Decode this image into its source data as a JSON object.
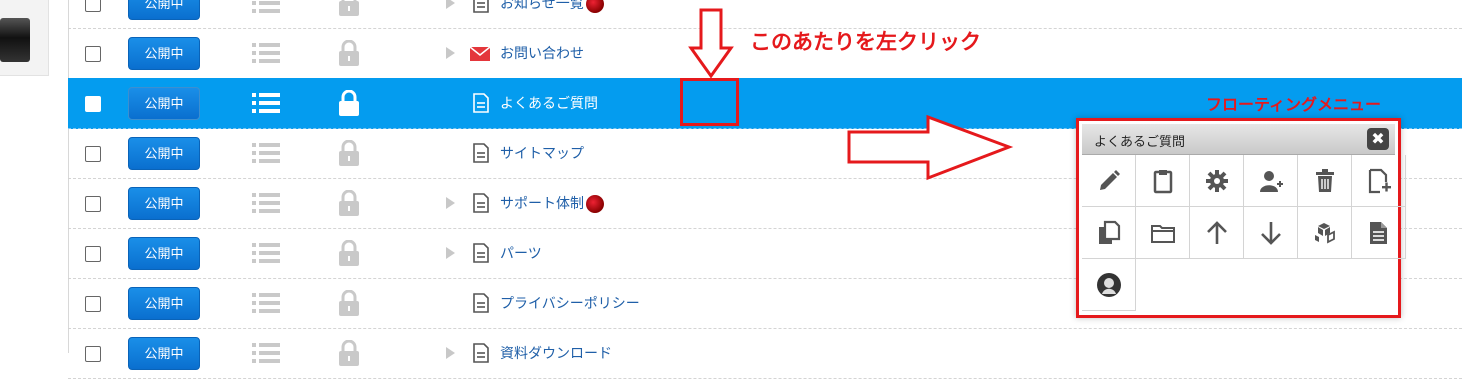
{
  "rows": [
    {
      "status": "公開中",
      "title": "お知らせ一覧",
      "has_children": true,
      "page_type": "page",
      "badge": true,
      "selected": false
    },
    {
      "status": "公開中",
      "title": "お問い合わせ",
      "has_children": true,
      "page_type": "mail",
      "badge": false,
      "selected": false
    },
    {
      "status": "公開中",
      "title": "よくあるご質問",
      "has_children": false,
      "page_type": "page",
      "badge": false,
      "selected": true
    },
    {
      "status": "公開中",
      "title": "サイトマップ",
      "has_children": false,
      "page_type": "page",
      "badge": false,
      "selected": false
    },
    {
      "status": "公開中",
      "title": "サポート体制",
      "has_children": true,
      "page_type": "page",
      "badge": true,
      "selected": false
    },
    {
      "status": "公開中",
      "title": "パーツ",
      "has_children": true,
      "page_type": "page",
      "badge": false,
      "selected": false
    },
    {
      "status": "公開中",
      "title": "プライバシーポリシー",
      "has_children": false,
      "page_type": "page",
      "badge": false,
      "selected": false
    },
    {
      "status": "公開中",
      "title": "資料ダウンロード",
      "has_children": true,
      "page_type": "page",
      "badge": false,
      "selected": false
    }
  ],
  "annotations": {
    "click_here": "このあたりを左クリック",
    "floating_menu": "フローティングメニュー"
  },
  "floating_menu": {
    "title": "よくあるご質問",
    "close_label": "✖",
    "items": [
      {
        "icon": "edit-icon"
      },
      {
        "icon": "clipboard-icon"
      },
      {
        "icon": "gear-icon"
      },
      {
        "icon": "add-user-icon"
      },
      {
        "icon": "trash-icon"
      },
      {
        "icon": "new-page-icon"
      },
      {
        "icon": "copy-icon"
      },
      {
        "icon": "folder-icon"
      },
      {
        "icon": "arrow-up-icon"
      },
      {
        "icon": "arrow-down-icon"
      },
      {
        "icon": "cubes-icon"
      },
      {
        "icon": "document-icon"
      },
      {
        "icon": "avatar-icon"
      }
    ]
  },
  "colors": {
    "selected_row": "#049cef",
    "annotation_red": "#e5191c",
    "publish_button": "#0a6fcf",
    "link": "#1f5fa8"
  }
}
